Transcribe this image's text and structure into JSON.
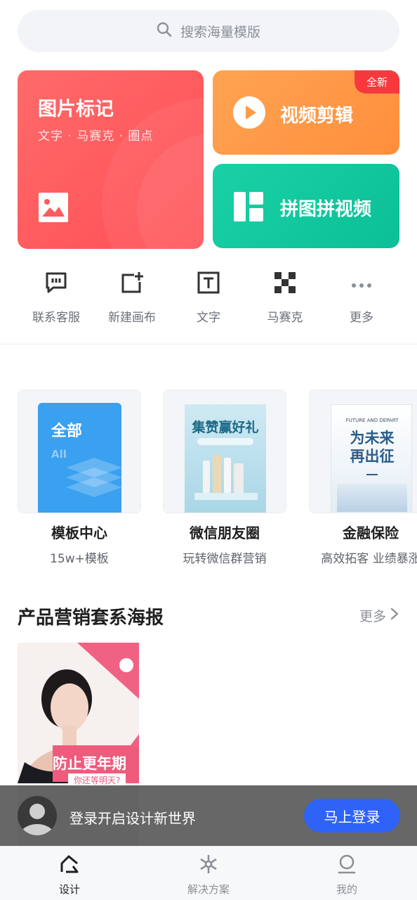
{
  "search": {
    "placeholder": "搜索海量模版",
    "icon": "search-icon"
  },
  "feature_cards": {
    "image_mark": {
      "title": "图片标记",
      "subtitle": "文字 · 马赛克 · 圈点",
      "icon": "image-icon",
      "color": "#ff5a5f"
    },
    "video_edit": {
      "title": "视频剪辑",
      "badge": "全新",
      "icon": "play-icon",
      "color": "#ff9a46"
    },
    "collage": {
      "title": "拼图拼视频",
      "icon": "collage-icon",
      "color": "#12c89e"
    }
  },
  "quick_actions": [
    {
      "label": "联系客服",
      "icon": "chat-icon"
    },
    {
      "label": "新建画布",
      "icon": "new-canvas-icon"
    },
    {
      "label": "文字",
      "icon": "text-icon"
    },
    {
      "label": "马赛克",
      "icon": "mosaic-icon"
    },
    {
      "label": "更多",
      "icon": "more-dots-icon"
    }
  ],
  "templates": [
    {
      "name": "模板中心",
      "subtitle": "15w+模板",
      "thumb_title": "全部",
      "thumb_sub": "All"
    },
    {
      "name": "微信朋友圈",
      "subtitle": "玩转微信群营销",
      "thumb_title": "集赞赢好礼"
    },
    {
      "name": "金融保险",
      "subtitle": "高效拓客 业绩暴涨",
      "thumb_title": "为未来再出征",
      "thumb_en": "FUTURE AND DEPART"
    }
  ],
  "section": {
    "title": "产品营销套系海报",
    "more": "更多"
  },
  "poster": {
    "headline": "防止更年期",
    "subline": "你还等明天?"
  },
  "login_banner": {
    "text": "登录开启设计新世界",
    "button": "马上登录"
  },
  "tabbar": [
    {
      "label": "设计",
      "icon": "design-icon",
      "active": true
    },
    {
      "label": "解决方案",
      "icon": "solution-icon",
      "active": false
    },
    {
      "label": "我的",
      "icon": "profile-icon",
      "active": false
    }
  ],
  "colors": {
    "accent": "#2f63f7",
    "red_card": "#ff5a5f",
    "orange_card": "#ff9a46",
    "green_card": "#12c89e",
    "new_badge": "#f7393e"
  }
}
